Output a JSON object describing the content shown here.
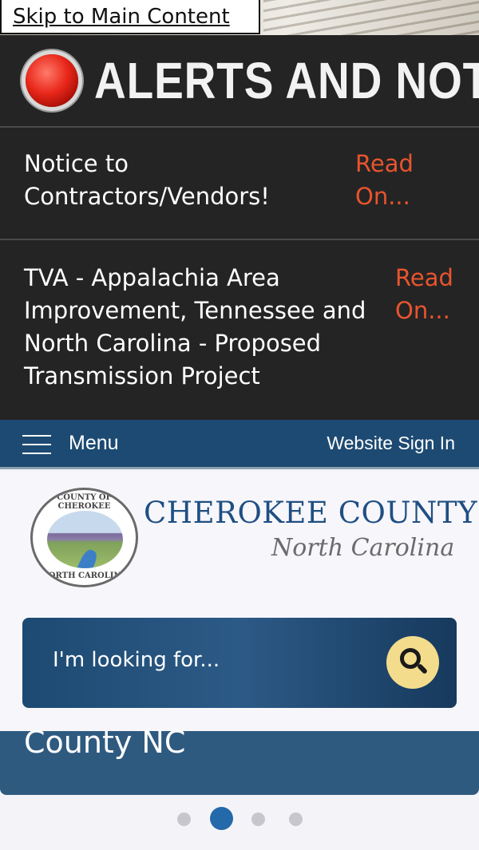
{
  "skip_link": "Skip to Main Content",
  "alerts": {
    "title": "ALERTS AND NOTIC",
    "items": [
      {
        "text": "Notice to Contractors/Vendors!",
        "more": "Read On..."
      },
      {
        "text": "TVA - Appalachia Area Improvement, Tennessee and North Carolina - Proposed Transmission Project",
        "more": "Read On..."
      }
    ]
  },
  "nav": {
    "menu_label": "Menu",
    "signin_label": "Website Sign In"
  },
  "header": {
    "county_name": "CHEROKEE COUNTY",
    "state_name": "North Carolina",
    "seal_top": "COUNTY OF CHEROKEE",
    "seal_bottom": "NORTH CAROLINA"
  },
  "search": {
    "placeholder": "I'm looking for..."
  },
  "slide": {
    "caption": "County NC"
  },
  "carousel": {
    "count": 4,
    "active_index": 1
  },
  "colors": {
    "alert_bg": "#242424",
    "read_more": "#e9542e",
    "nav_bg": "#1d4a72",
    "brand_blue": "#1f4f82",
    "search_button": "#f3dc8c",
    "active_dot": "#2469a9"
  }
}
